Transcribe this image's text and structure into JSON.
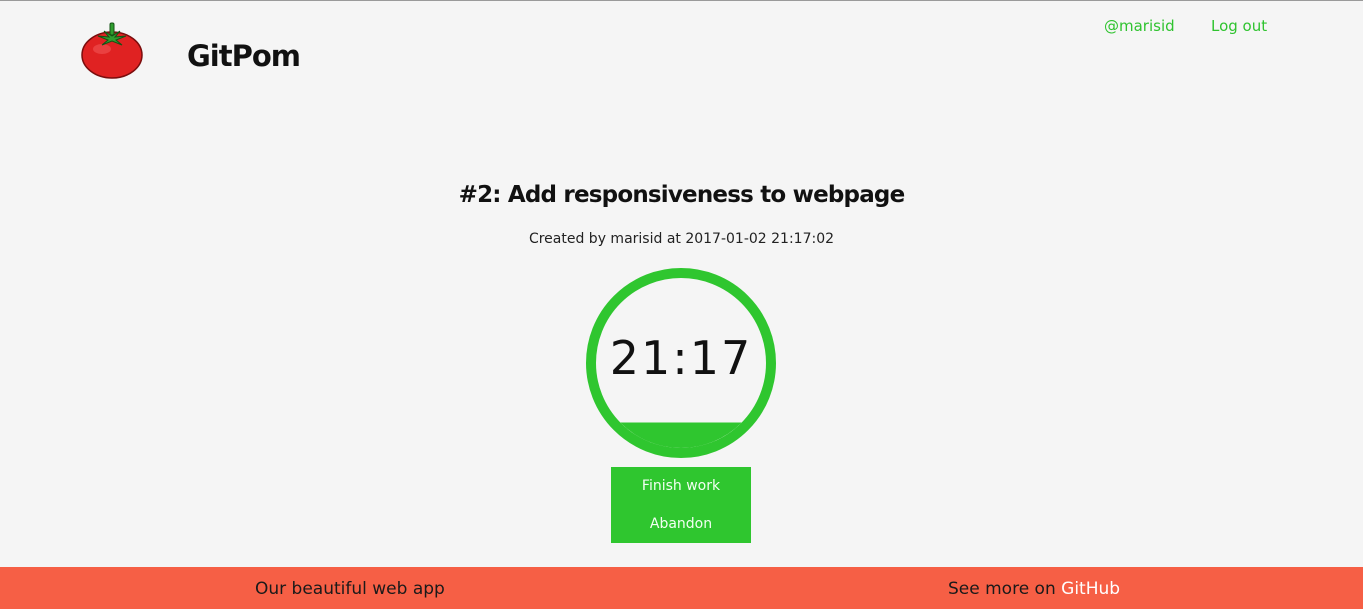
{
  "header": {
    "brand": "GitPom",
    "logo_icon": "tomato-icon",
    "nav": {
      "user": "@marisid",
      "logout": "Log out"
    }
  },
  "task": {
    "title": "#2: Add responsiveness to webpage",
    "meta": "Created by marisid at 2017-01-02 21:17:02",
    "timer": "21:17",
    "progress_fill_fraction": 0.15
  },
  "actions": {
    "finish": "Finish work",
    "abandon": "Abandon"
  },
  "footer": {
    "left_text": "Our beautiful web app",
    "right_prefix": "See more on ",
    "right_link": "GitHub"
  },
  "colors": {
    "accent_green": "#2fc62f",
    "footer_red": "#f65f45",
    "background": "#f5f5f5"
  }
}
